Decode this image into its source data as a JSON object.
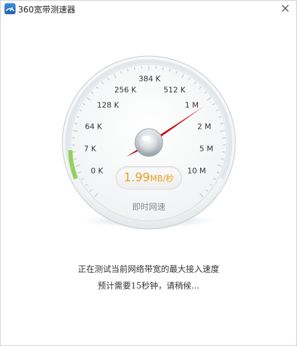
{
  "window": {
    "title": "360宽带测速器",
    "icons": {
      "app": "360-speedtest-app-icon",
      "close": "close-icon"
    }
  },
  "gauge": {
    "scale_labels": [
      "0 K",
      "7 K",
      "64 K",
      "128 K",
      "256 K",
      "384 K",
      "512 K",
      "1 M",
      "2 M",
      "5 M",
      "10 M"
    ],
    "speed_value": "1.99",
    "speed_unit": "MB/秒",
    "realtime_label": "即时网速",
    "accent_colors": {
      "needle": "#c8141c",
      "progress": "#8fd35a",
      "speed_text": "#e7a21b"
    }
  },
  "status": {
    "line1": "正在测试当前网络带宽的最大接入速度",
    "line2": "预计需要15秒钟，请稍候..."
  }
}
